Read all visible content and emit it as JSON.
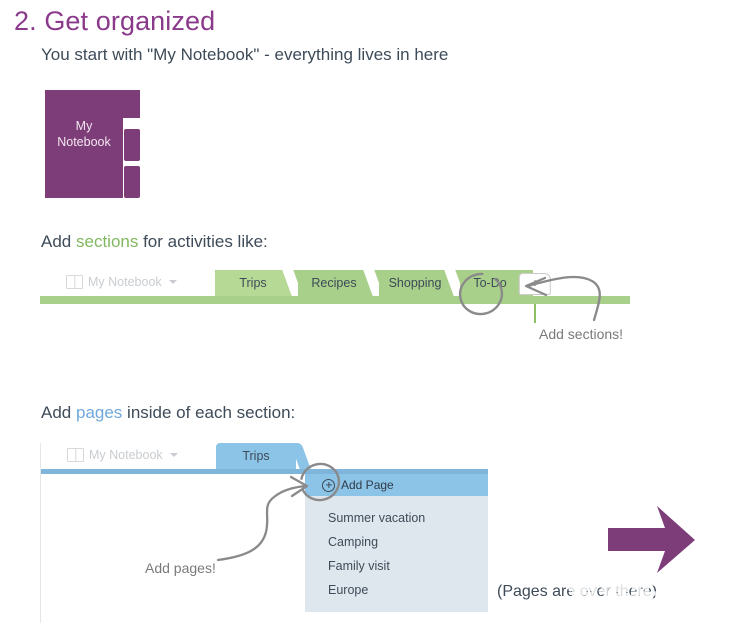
{
  "page": {
    "title": "2. Get organized",
    "subtitle": "You start with \"My Notebook\" - everything lives in here"
  },
  "notebook": {
    "label_line1": "My",
    "label_line2": "Notebook",
    "color": "#7D3D79"
  },
  "prompts": {
    "sections": {
      "before": "Add ",
      "highlight": "sections",
      "after": " for activities like:",
      "highlight_color": "#81B860"
    },
    "pages": {
      "before": "Add ",
      "highlight": "pages",
      "after": " inside of each section:",
      "highlight_color": "#6FA8DC"
    }
  },
  "sections_demo": {
    "notebook_button": "My Notebook",
    "notebook_icon": "notebook-icon",
    "caret_icon": "chevron-down-icon",
    "tabs": [
      {
        "label": "Trips",
        "active": true
      },
      {
        "label": "Recipes",
        "active": false
      },
      {
        "label": "Shopping",
        "active": false
      },
      {
        "label": "To-Do",
        "active": false
      }
    ],
    "add_section_label": "+",
    "accent_color": "#A9D08A",
    "active_color": "#B6D996"
  },
  "pages_demo": {
    "notebook_button": "My Notebook",
    "notebook_icon": "notebook-icon",
    "caret_icon": "chevron-down-icon",
    "tab_label": "Trips",
    "add_page_label": "Add Page",
    "pages": [
      "Summer vacation",
      "Camping",
      "Family visit",
      "Europe"
    ],
    "accent_color": "#8CC4E8",
    "list_background": "#DFE7EE"
  },
  "annotations": {
    "add_sections": "Add sections!",
    "add_pages": "Add pages!",
    "pages_over_there": "(Pages are over there)",
    "arrow_color": "#7D3D79",
    "ink_color": "#8A8A8A"
  },
  "watermark": {
    "text": "值得买"
  }
}
